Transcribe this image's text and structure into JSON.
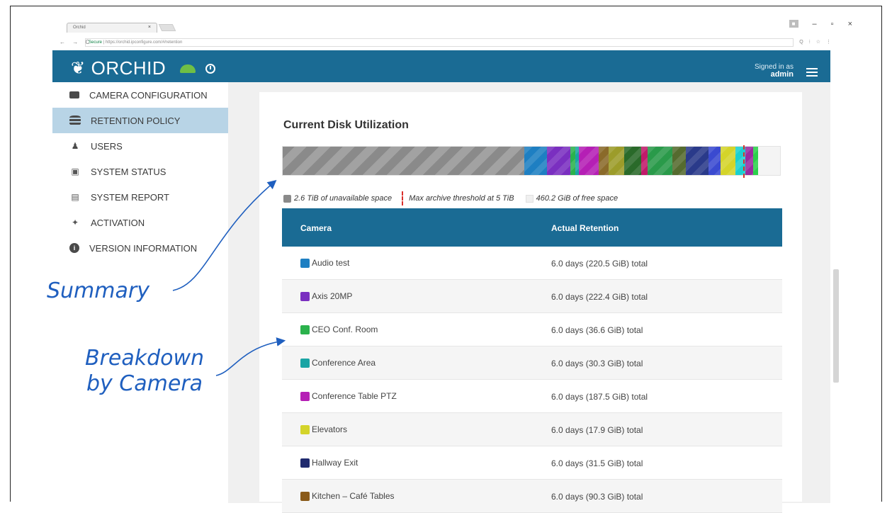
{
  "browser": {
    "tab_title": "Orchid",
    "tab_close": "×",
    "url_secure": "Secure",
    "url": "https://orchid.ipconfigure.com/#/retention",
    "nav_buttons": "← → C",
    "addr_icons": "Q ⁝ ☆ ⋮",
    "window_controls": {
      "minimize": "–",
      "maximize": "▫",
      "close": "×"
    }
  },
  "header": {
    "app_name": "ORCHID",
    "signed_in_label": "Signed in as",
    "user": "admin"
  },
  "sidebar": {
    "items": [
      {
        "label": "CAMERA CONFIGURATION",
        "icon": "video-camera-icon"
      },
      {
        "label": "RETENTION POLICY",
        "icon": "database-icon",
        "active": true
      },
      {
        "label": "USERS",
        "icon": "user-icon"
      },
      {
        "label": "SYSTEM STATUS",
        "icon": "medkit-icon"
      },
      {
        "label": "SYSTEM REPORT",
        "icon": "report-icon"
      },
      {
        "label": "ACTIVATION",
        "icon": "magic-wand-icon"
      },
      {
        "label": "VERSION INFORMATION",
        "icon": "info-icon"
      }
    ]
  },
  "main": {
    "title": "Current Disk Utilization",
    "disk_bar": {
      "unavailable_fraction": 0.486,
      "camera_segments": [
        {
          "color": "#1e7fc2",
          "fraction": 0.045
        },
        {
          "color": "#7a2fc0",
          "fraction": 0.047
        },
        {
          "color": "#2bb24c",
          "fraction": 0.01
        },
        {
          "color": "#1aa4a4",
          "fraction": 0.008
        },
        {
          "color": "#b51fb5",
          "fraction": 0.04
        },
        {
          "color": "#8a6a2a",
          "fraction": 0.02
        },
        {
          "color": "#9c9c2a",
          "fraction": 0.03
        },
        {
          "color": "#2a6a2a",
          "fraction": 0.035
        },
        {
          "color": "#c01a6a",
          "fraction": 0.012
        },
        {
          "color": "#2a9a4a",
          "fraction": 0.05
        },
        {
          "color": "#556b2f",
          "fraction": 0.028
        },
        {
          "color": "#2a3a8a",
          "fraction": 0.045
        },
        {
          "color": "#3a4ad0",
          "fraction": 0.025
        },
        {
          "color": "#d4d42a",
          "fraction": 0.03
        },
        {
          "color": "#1ad0d0",
          "fraction": 0.02
        },
        {
          "color": "#9a2aa0",
          "fraction": 0.015
        },
        {
          "color": "#2ad04a",
          "fraction": 0.01
        }
      ],
      "threshold_color": "#d9302c",
      "free_color": "#f4f4f4"
    },
    "legend": {
      "unavailable": "2.6 TiB of unavailable space",
      "threshold": "Max archive threshold at 5 TiB",
      "free": "460.2 GiB of free space"
    },
    "table": {
      "columns": [
        "Camera",
        "Actual Retention"
      ],
      "rows": [
        {
          "camera": "Audio test",
          "retention": "6.0 days (220.5 GiB) total",
          "color": "#1e7fc2"
        },
        {
          "camera": "Axis 20MP",
          "retention": "6.0 days (222.4 GiB) total",
          "color": "#7a2fc0"
        },
        {
          "camera": "CEO Conf. Room",
          "retention": "6.0 days (36.6 GiB) total",
          "color": "#2bb24c"
        },
        {
          "camera": "Conference Area",
          "retention": "6.0 days (30.3 GiB) total",
          "color": "#1aa4a4"
        },
        {
          "camera": "Conference Table PTZ",
          "retention": "6.0 days (187.5 GiB) total",
          "color": "#b51fb5"
        },
        {
          "camera": "Elevators",
          "retention": "6.0 days (17.9 GiB) total",
          "color": "#d4d42a"
        },
        {
          "camera": "Hallway Exit",
          "retention": "6.0 days (31.5 GiB) total",
          "color": "#1f2a6e"
        },
        {
          "camera": "Kitchen – Café Tables",
          "retention": "6.0 days (90.3 GiB) total",
          "color": "#8a5a1a"
        }
      ]
    }
  },
  "annotations": {
    "summary": "Summary",
    "breakdown_line1": "Breakdown",
    "breakdown_line2": "by Camera",
    "color": "#1f5fbf"
  }
}
